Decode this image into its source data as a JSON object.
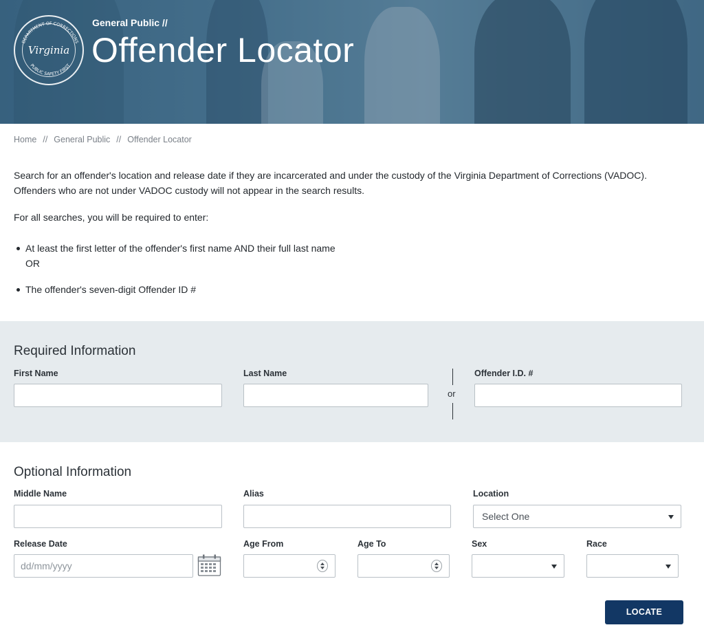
{
  "header": {
    "kicker": "General Public //",
    "title": "Offender Locator",
    "seal_text": "Virginia",
    "seal_ring_top": "DEPARTMENT OF CORRECTIONS",
    "seal_ring_bottom": "PUBLIC SAFETY FIRST"
  },
  "breadcrumb": {
    "items": [
      "Home",
      "General Public",
      "Offender Locator"
    ],
    "separator": "//"
  },
  "intro": {
    "paragraph": "Search for an offender's location and release date if they are incarcerated and under the custody of the Virginia Department of Corrections (VADOC). Offenders who are not under VADOC custody will not appear in the search results.",
    "requirement_lead": "For all searches, you will be required to enter:",
    "bullet_1": "At least the first letter of the offender's first name AND their full last name",
    "bullet_1_or": "OR",
    "bullet_2": "The offender's seven-digit Offender ID #"
  },
  "required": {
    "title": "Required Information",
    "first_name_label": "First Name",
    "last_name_label": "Last Name",
    "or_label": "or",
    "offender_id_label": "Offender I.D. #"
  },
  "optional": {
    "title": "Optional Information",
    "middle_name_label": "Middle Name",
    "alias_label": "Alias",
    "location_label": "Location",
    "location_value": "Select One",
    "release_date_label": "Release Date",
    "release_date_placeholder": "dd/mm/yyyy",
    "age_from_label": "Age From",
    "age_to_label": "Age To",
    "sex_label": "Sex",
    "race_label": "Race"
  },
  "actions": {
    "locate_label": "LOCATE"
  },
  "colors": {
    "button": "#123764",
    "required_bg": "#e6ebee"
  }
}
